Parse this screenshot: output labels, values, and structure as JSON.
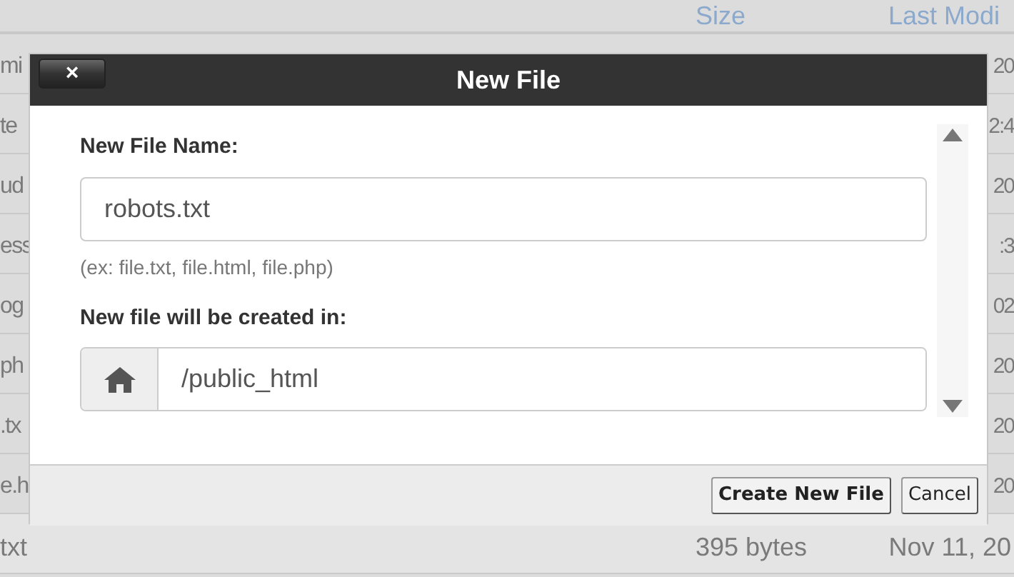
{
  "file_table": {
    "columns": [
      "Size",
      "Last Modi"
    ],
    "rows": [
      {
        "column_1": "mi",
        "column_2": "",
        "column_3": "20",
        "selected": false
      },
      {
        "column_1": "te",
        "column_2": "",
        "column_3": "2:4",
        "selected": false
      },
      {
        "column_1": "ud",
        "column_2": "",
        "column_3": "20",
        "selected": false
      },
      {
        "column_1": "ess",
        "column_2": "",
        "column_3": ":3",
        "selected": false
      },
      {
        "column_1": "og",
        "column_2": "",
        "column_3": "02",
        "selected": false
      },
      {
        "column_1": "ph",
        "column_2": "",
        "column_3": "20",
        "selected": false
      },
      {
        "column_1": ".tx",
        "column_2": "",
        "column_3": "20",
        "selected": false
      },
      {
        "column_1": "e.h",
        "column_2": "",
        "column_3": "20",
        "selected": false
      },
      {
        "column_1": "txt",
        "column_2": "395 bytes",
        "column_3": "Nov 11, 20",
        "selected": true
      }
    ]
  },
  "dialog": {
    "title": "New File",
    "close_button": "×",
    "name_label": "New File Name:",
    "name_value": "robots.txt",
    "name_hint": "(ex: file.txt, file.html, file.php)",
    "location_label": "New file will be created in:",
    "location_value": "/public_html",
    "buttons": [
      {
        "label": "Create New File",
        "primary": true
      },
      {
        "label": "Cancel",
        "primary": false
      }
    ]
  }
}
